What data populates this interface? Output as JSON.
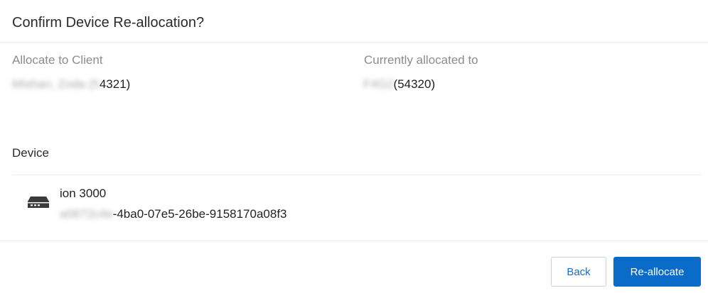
{
  "dialog": {
    "title": "Confirm Device Re-allocation?"
  },
  "allocate_to": {
    "label": "Allocate to Client",
    "value_redacted": "Mishan, Zoda (5",
    "value_visible": "4321)"
  },
  "currently_allocated": {
    "label": "Currently allocated to",
    "value_redacted": "F4G2",
    "value_visible": " (54320)"
  },
  "device_section": {
    "title": "Device",
    "device": {
      "icon": "network-device-icon",
      "name": "ion 3000",
      "id_redacted": "a0872c4e",
      "id_visible": "-4ba0-07e5-26be-9158170a08f3"
    }
  },
  "footer": {
    "back_label": "Back",
    "confirm_label": "Re-allocate"
  },
  "colors": {
    "primary": "#0a6bc8",
    "link": "#1b6ec2",
    "muted_label": "#8c8c8c",
    "divider": "#ececec"
  }
}
